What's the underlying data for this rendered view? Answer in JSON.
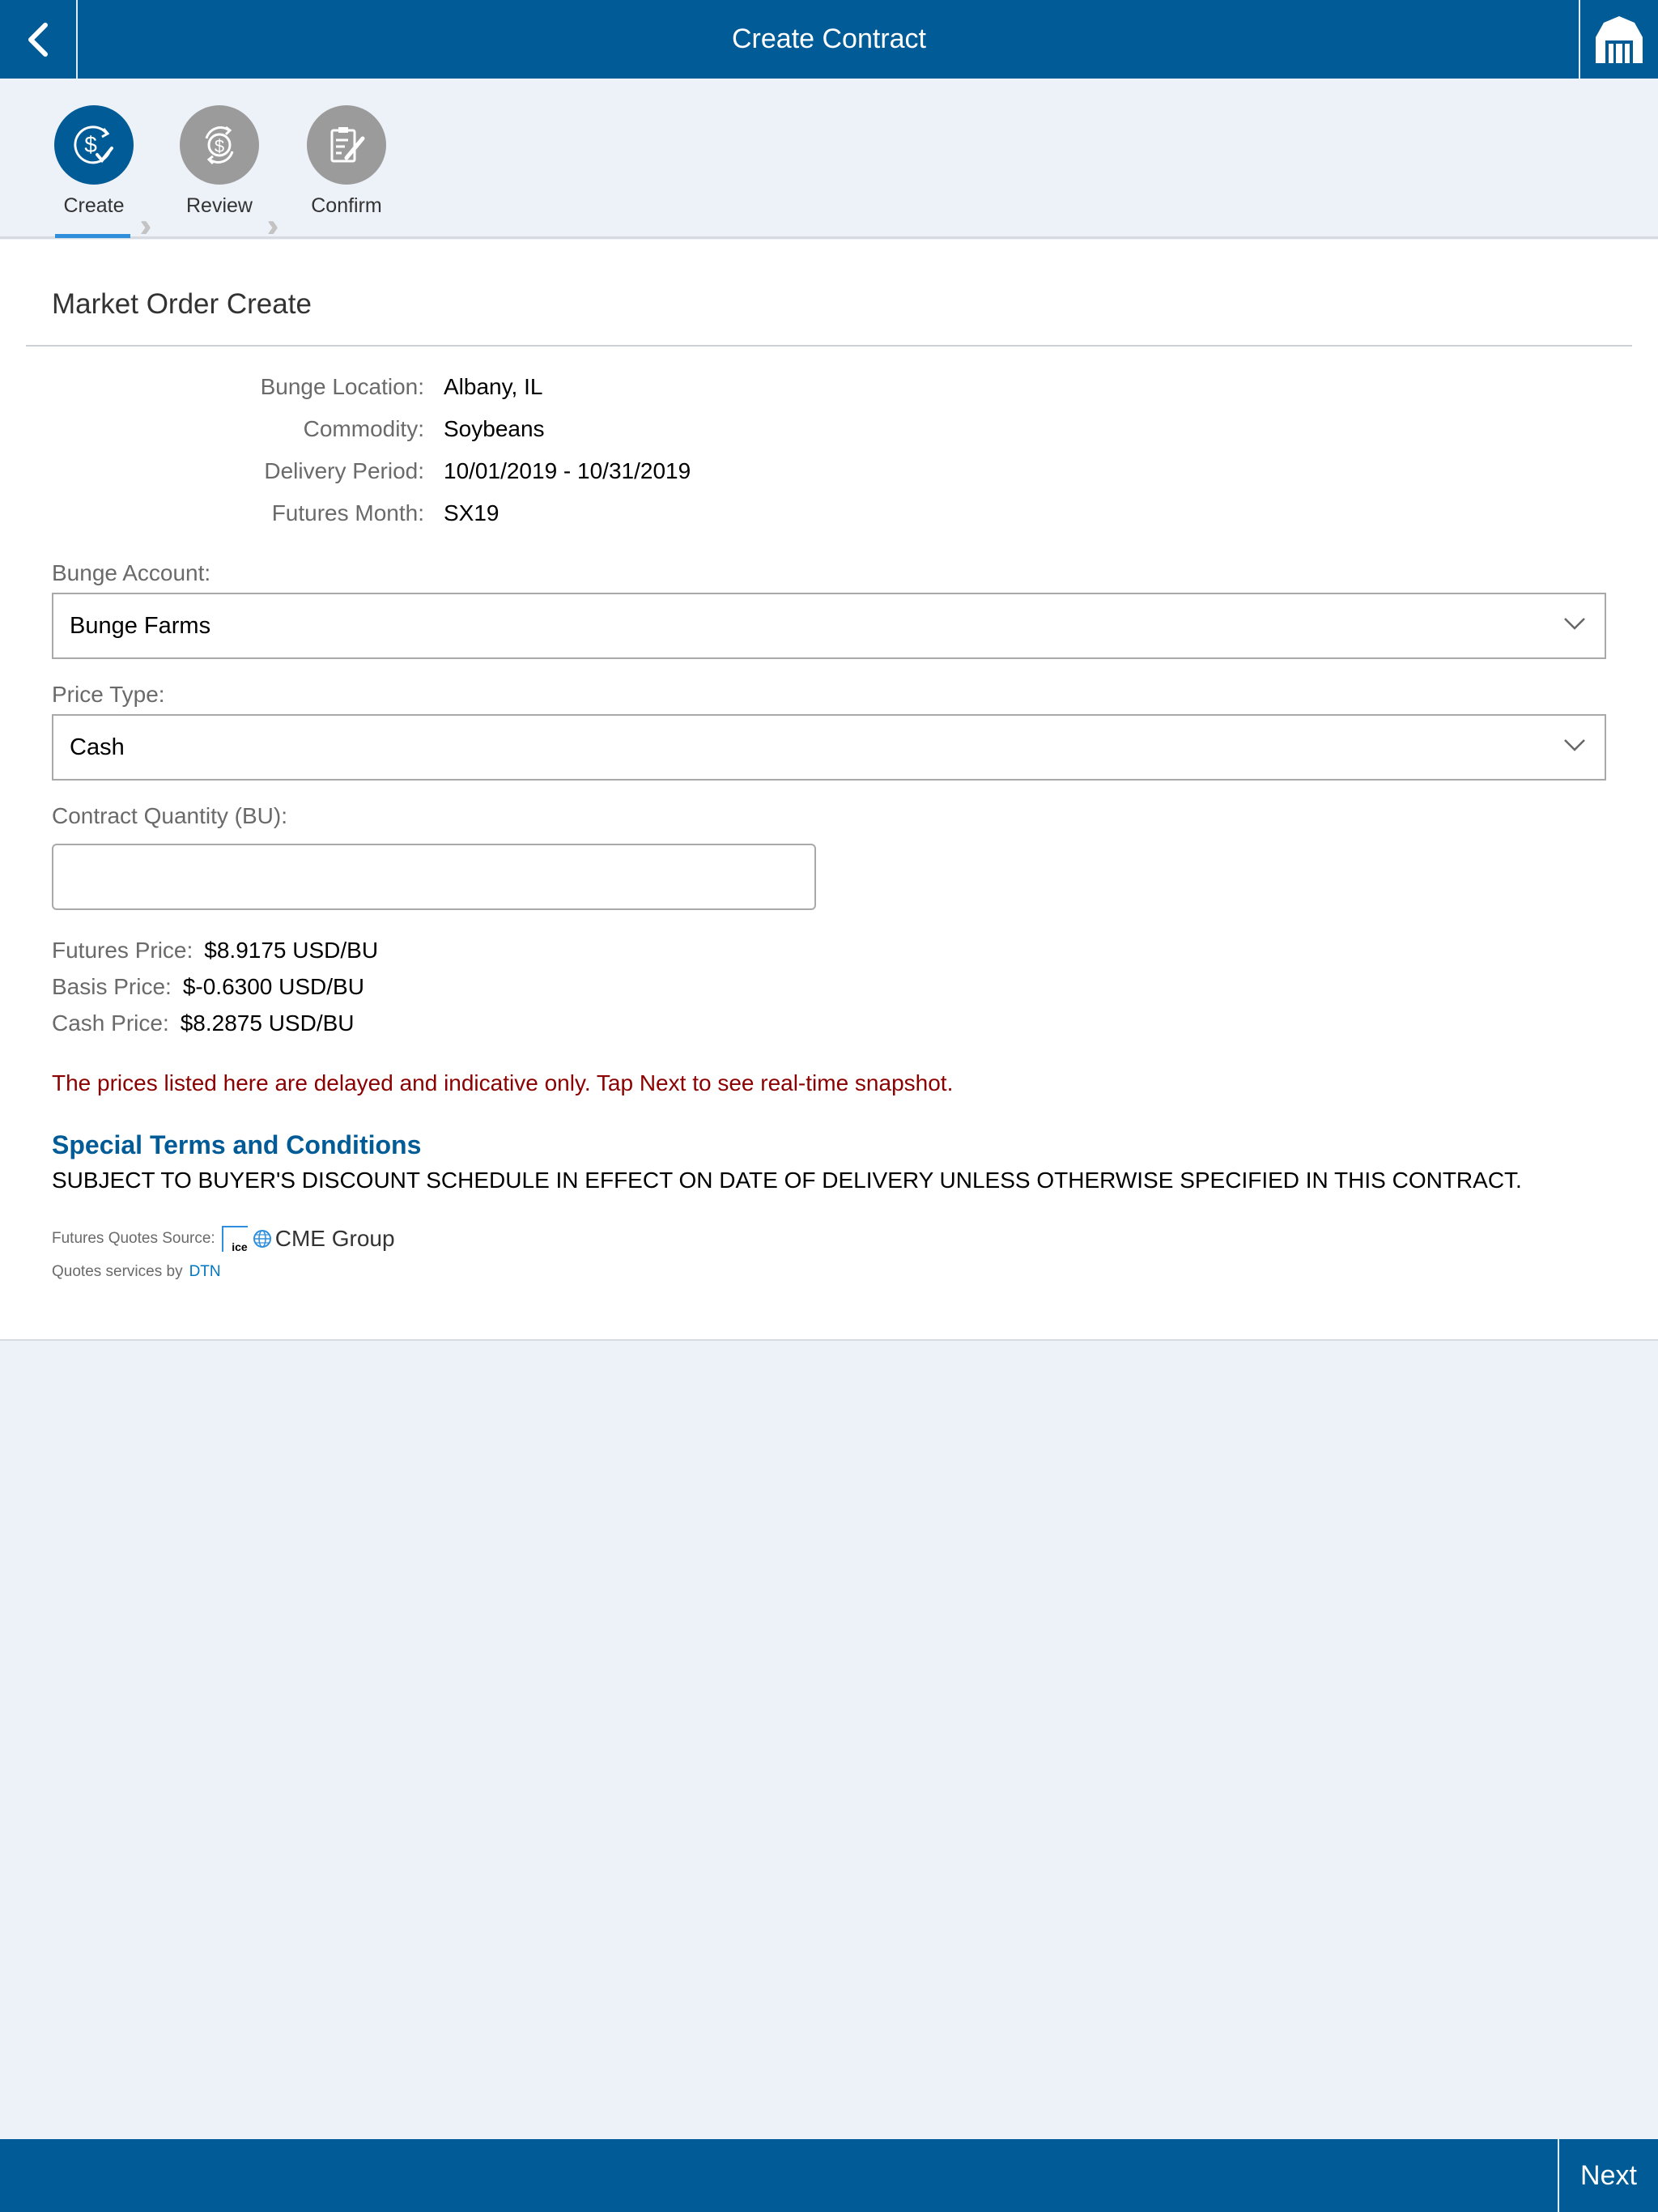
{
  "header": {
    "title": "Create Contract",
    "back_icon": "chevron-left-icon",
    "home_icon": "barn-icon"
  },
  "stepper": {
    "steps": [
      {
        "label": "Create",
        "icon": "dollar-check-icon",
        "active": true
      },
      {
        "label": "Review",
        "icon": "dollar-refresh-icon",
        "active": false
      },
      {
        "label": "Confirm",
        "icon": "document-pen-icon",
        "active": false
      }
    ]
  },
  "form": {
    "title": "Market Order Create",
    "details": [
      {
        "label": "Bunge Location:",
        "value": "Albany, IL"
      },
      {
        "label": "Commodity:",
        "value": "Soybeans"
      },
      {
        "label": "Delivery Period:",
        "value": "10/01/2019 - 10/31/2019"
      },
      {
        "label": "Futures Month:",
        "value": "SX19"
      }
    ],
    "account": {
      "label": "Bunge Account:",
      "value": "Bunge Farms"
    },
    "price_type": {
      "label": "Price Type:",
      "value": "Cash"
    },
    "quantity": {
      "label": "Contract Quantity (BU):",
      "value": "",
      "placeholder": ""
    },
    "prices": [
      {
        "label": "Futures Price:",
        "value": "$8.9175 USD/BU"
      },
      {
        "label": "Basis Price:",
        "value": "$-0.6300 USD/BU"
      },
      {
        "label": "Cash Price:",
        "value": "$8.2875 USD/BU"
      }
    ],
    "notice": "The prices listed here are delayed and indicative only. Tap Next to see real-time snapshot.",
    "terms_title": "Special Terms and Conditions",
    "terms_text": "SUBJECT TO BUYER'S DISCOUNT SCHEDULE IN EFFECT ON DATE OF DELIVERY UNLESS OTHERWISE SPECIFIED IN THIS CONTRACT.",
    "quotes_source_label": "Futures Quotes Source:",
    "ice_logo_text": "ice",
    "cme_logo_text": "CME Group",
    "quotes_services_label": "Quotes services by",
    "dtn_link": "DTN"
  },
  "footer": {
    "next_label": "Next"
  },
  "colors": {
    "brand": "#005b96",
    "active_step": "#005b96",
    "inactive_step": "#9b9b9b",
    "notice": "#8b0000",
    "link": "#0077c0"
  }
}
